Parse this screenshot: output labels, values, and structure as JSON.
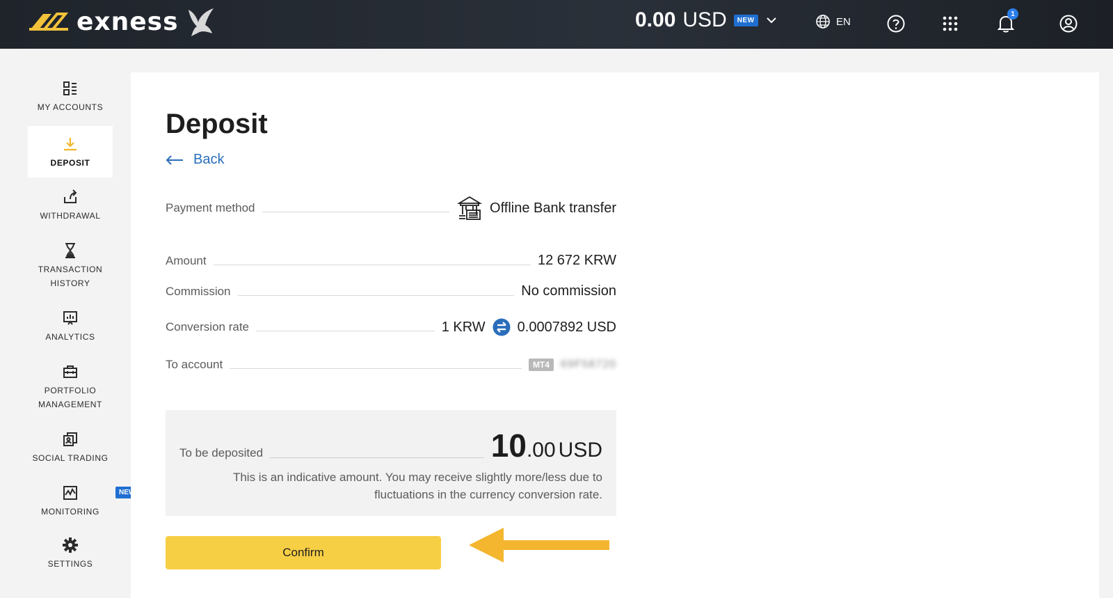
{
  "header": {
    "brand": "exness",
    "balance_amount": "0.00",
    "balance_currency": "USD",
    "balance_badge": "NEW",
    "language": "EN",
    "notification_count": "1",
    "icons": [
      "globe-icon",
      "help-icon",
      "apps-grid-icon",
      "bell-icon",
      "user-icon",
      "chevron-down-icon"
    ]
  },
  "sidebar": {
    "items": [
      {
        "label": "MY ACCOUNTS",
        "icon": "dashboard-icon"
      },
      {
        "label": "DEPOSIT",
        "icon": "download-icon",
        "active": true
      },
      {
        "label": "WITHDRAWAL",
        "icon": "upload-share-icon"
      },
      {
        "label": "TRANSACTION HISTORY",
        "icon": "hourglass-icon"
      },
      {
        "label": "ANALYTICS",
        "icon": "analytics-icon"
      },
      {
        "label": "PORTFOLIO MANAGEMENT",
        "icon": "briefcase-icon"
      },
      {
        "label": "SOCIAL TRADING",
        "icon": "social-copy-icon"
      },
      {
        "label": "MONITORING",
        "icon": "monitor-chart-icon",
        "badge": "NEW"
      },
      {
        "label": "SETTINGS",
        "icon": "gear-icon"
      }
    ]
  },
  "main": {
    "title": "Deposit",
    "back_label": "Back",
    "payment_method_label": "Payment method",
    "payment_method_value": "Offline Bank transfer",
    "amount_label": "Amount",
    "amount_value": "12 672 KRW",
    "commission_label": "Commission",
    "commission_value": "No commission",
    "conversion_label": "Conversion rate",
    "conversion_from": "1 KRW",
    "conversion_to": "0.0007892 USD",
    "to_account_label": "To account",
    "to_account_platform": "MT4",
    "to_account_number": "69F58720",
    "deposit_label": "To be deposited",
    "deposit_int": "10",
    "deposit_dec": ".00",
    "deposit_currency": "USD",
    "deposit_note": "This is an indicative amount. You may receive slightly more/less due to fluctuations in the currency conversion rate.",
    "confirm_label": "Confirm"
  },
  "colors": {
    "accent_yellow": "#f7cf45",
    "link_blue": "#2a6ebb",
    "badge_blue": "#1f6fd1",
    "arrow": "#f4b62f"
  }
}
